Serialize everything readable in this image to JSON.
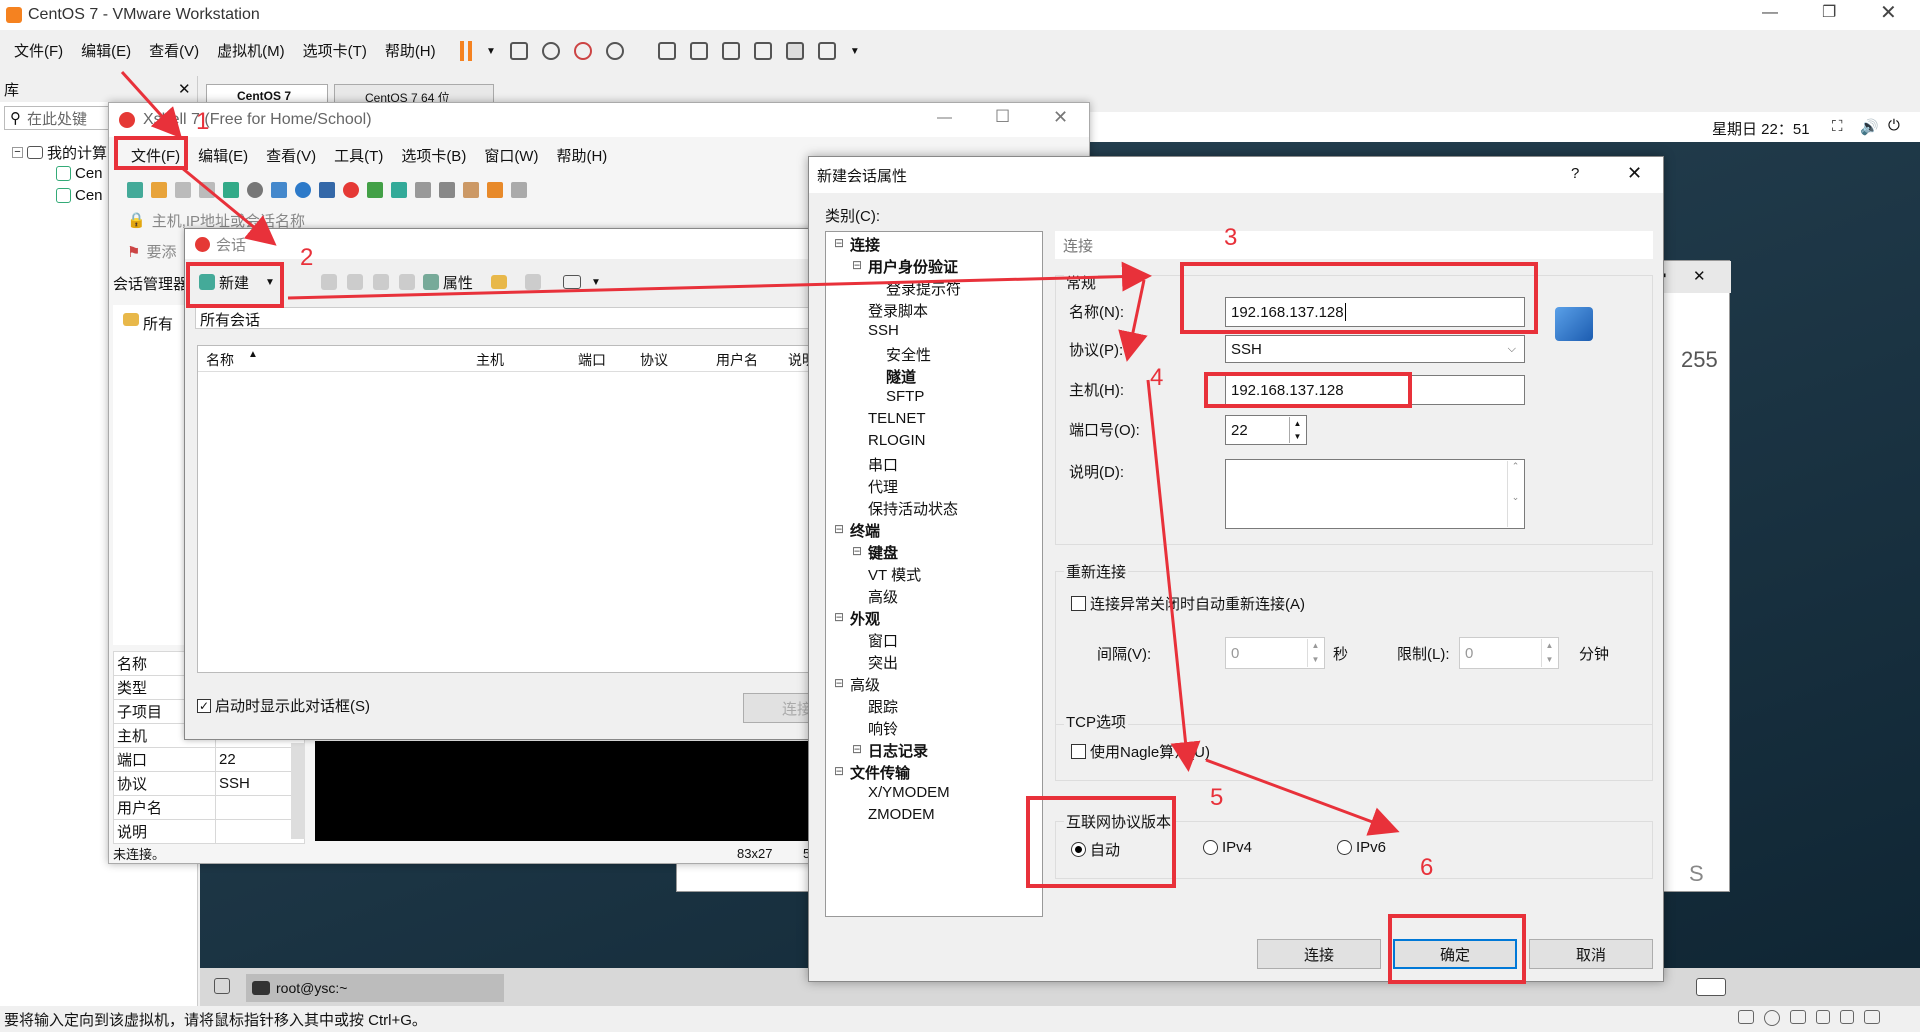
{
  "vmware": {
    "title": "CentOS 7 - VMware Workstation",
    "menu": [
      "文件(F)",
      "编辑(E)",
      "查看(V)",
      "虚拟机(M)",
      "选项卡(T)",
      "帮助(H)"
    ],
    "library": "库",
    "search_placeholder": "在此处键",
    "tree_root": "我的计算",
    "tree_items": [
      "Cen",
      "Cen"
    ],
    "tabs": [
      "CentOS 7",
      "CentOS 7 64 位"
    ],
    "clock": "星期日 22：51",
    "vm_user": "root@ysc:~",
    "statusbar": "要将输入定向到该虚拟机，请将鼠标指针移入其中或按 Ctrl+G。",
    "bg_text1": "255",
    "bg_text2": "S"
  },
  "xshell": {
    "title": "Xshell 7 (Free for Home/School)",
    "menu": [
      "文件(F)",
      "编辑(E)",
      "查看(V)",
      "工具(T)",
      "选项卡(B)",
      "窗口(W)",
      "帮助(H)"
    ],
    "address_placeholder": "主机,IP地址或会话名称",
    "hint": "要添",
    "session_manager": "会话管理器",
    "all_sessions_short": "所有",
    "props": [
      [
        "名称",
        ""
      ],
      [
        "类型",
        ""
      ],
      [
        "子项目",
        ""
      ],
      [
        "主机",
        ""
      ],
      [
        "端口",
        "22"
      ],
      [
        "协议",
        "SSH"
      ],
      [
        "用户名",
        ""
      ],
      [
        "说明",
        ""
      ]
    ],
    "status": "未连接。",
    "size": "83x27",
    "num": "5"
  },
  "sessions": {
    "title": "会话",
    "new_btn": "新建",
    "prop_btn": "属性",
    "all_sessions": "所有会话",
    "columns": [
      "名称",
      "主机",
      "端口",
      "协议",
      "用户名",
      "说明"
    ],
    "startup_check": "启动时显示此对话框(S)",
    "connect": "连接"
  },
  "dialog": {
    "title": "新建会话属性",
    "help": "?",
    "category_label": "类别(C):",
    "tree": [
      {
        "t": "连接",
        "b": true,
        "l": 0
      },
      {
        "t": "用户身份验证",
        "b": true,
        "l": 1
      },
      {
        "t": "登录提示符",
        "b": false,
        "l": 2
      },
      {
        "t": "登录脚本",
        "b": false,
        "l": 1
      },
      {
        "t": "SSH",
        "b": false,
        "l": 1
      },
      {
        "t": "安全性",
        "b": false,
        "l": 2
      },
      {
        "t": "隧道",
        "b": true,
        "l": 2
      },
      {
        "t": "SFTP",
        "b": false,
        "l": 2
      },
      {
        "t": "TELNET",
        "b": false,
        "l": 1
      },
      {
        "t": "RLOGIN",
        "b": false,
        "l": 1
      },
      {
        "t": "串口",
        "b": false,
        "l": 1
      },
      {
        "t": "代理",
        "b": false,
        "l": 1
      },
      {
        "t": "保持活动状态",
        "b": false,
        "l": 1
      },
      {
        "t": "终端",
        "b": true,
        "l": 0
      },
      {
        "t": "键盘",
        "b": true,
        "l": 1
      },
      {
        "t": "VT 模式",
        "b": false,
        "l": 1
      },
      {
        "t": "高级",
        "b": false,
        "l": 1
      },
      {
        "t": "外观",
        "b": true,
        "l": 0
      },
      {
        "t": "窗口",
        "b": false,
        "l": 1
      },
      {
        "t": "突出",
        "b": false,
        "l": 1
      },
      {
        "t": "高级",
        "b": false,
        "l": 0
      },
      {
        "t": "跟踪",
        "b": false,
        "l": 1
      },
      {
        "t": "响铃",
        "b": false,
        "l": 1
      },
      {
        "t": "日志记录",
        "b": true,
        "l": 1
      },
      {
        "t": "文件传输",
        "b": true,
        "l": 0
      },
      {
        "t": "X/YMODEM",
        "b": false,
        "l": 1
      },
      {
        "t": "ZMODEM",
        "b": false,
        "l": 1
      }
    ],
    "section_connect": "连接",
    "section_general": "常规",
    "name_label": "名称(N):",
    "name_value": "192.168.137.128",
    "protocol_label": "协议(P):",
    "protocol_value": "SSH",
    "host_label": "主机(H):",
    "host_value": "192.168.137.128",
    "port_label": "端口号(O):",
    "port_value": "22",
    "desc_label": "说明(D):",
    "reconnect_title": "重新连接",
    "reconnect_check": "连接异常关闭时自动重新连接(A)",
    "interval_label": "间隔(V):",
    "interval_value": "0",
    "sec": "秒",
    "limit_label": "限制(L):",
    "limit_value": "0",
    "minute": "分钟",
    "tcp_title": "TCP选项",
    "nagle": "使用Nagle算法(U)",
    "ip_title": "互联网协议版本",
    "ip_opts": [
      "自动",
      "IPv4",
      "IPv6"
    ],
    "btn_connect": "连接",
    "btn_ok": "确定",
    "btn_cancel": "取消"
  },
  "annotations": [
    "1",
    "2",
    "3",
    "4",
    "5",
    "6"
  ]
}
